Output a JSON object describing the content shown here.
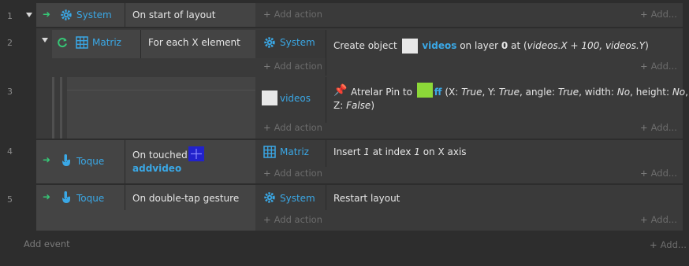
{
  "rows": [
    {
      "number": "1",
      "object": "System",
      "condition": "On start of layout"
    },
    {
      "number": "2",
      "object": "Matriz",
      "condition": "For each X element",
      "action": {
        "object": "System",
        "prefix": "Create object",
        "obj": "videos",
        "mid": "on layer",
        "layer": "0",
        "at": "at (",
        "expr": "videos.X + 100, videos.Y",
        "end": ")"
      }
    },
    {
      "number": "3",
      "action": {
        "object": "videos",
        "verb": "Atrelar Pin to",
        "target": "ff",
        "params_line1_start": "(X:",
        "v1": "True",
        "s1": ", Y:",
        "v2": "True",
        "s2": ", angle:",
        "v3": "True",
        "s3": ", width:",
        "v4": "No",
        "s4": ", height:",
        "v5": "No",
        "s5": ",",
        "line2_start": "Z:",
        "v6": "False",
        "line2_end": ")"
      }
    },
    {
      "number": "4",
      "object": "Toque",
      "condition": "On touched",
      "condition_obj": "addvideo",
      "action": {
        "object": "Matriz",
        "w1": "Insert",
        "v1": "1",
        "w2": "at index",
        "v2": "1",
        "w3": "on X axis"
      }
    },
    {
      "number": "5",
      "object": "Toque",
      "condition": "On double-tap gesture",
      "action": {
        "object": "System",
        "text": "Restart layout"
      }
    }
  ],
  "labels": {
    "add_action": "Add action",
    "add": "Add...",
    "add_event": "Add event"
  },
  "icons": {
    "system": "gear-icon",
    "matriz": "grid-icon",
    "toque": "touch-icon",
    "loop": "loop-icon",
    "trigger": "trigger-arrow-icon",
    "pin": "pin-icon"
  },
  "colors": {
    "accent": "#3aa8e6",
    "trigger": "#36c776",
    "swatch_ff": "#8cd838",
    "swatch_addvideo": "#2222cc"
  }
}
